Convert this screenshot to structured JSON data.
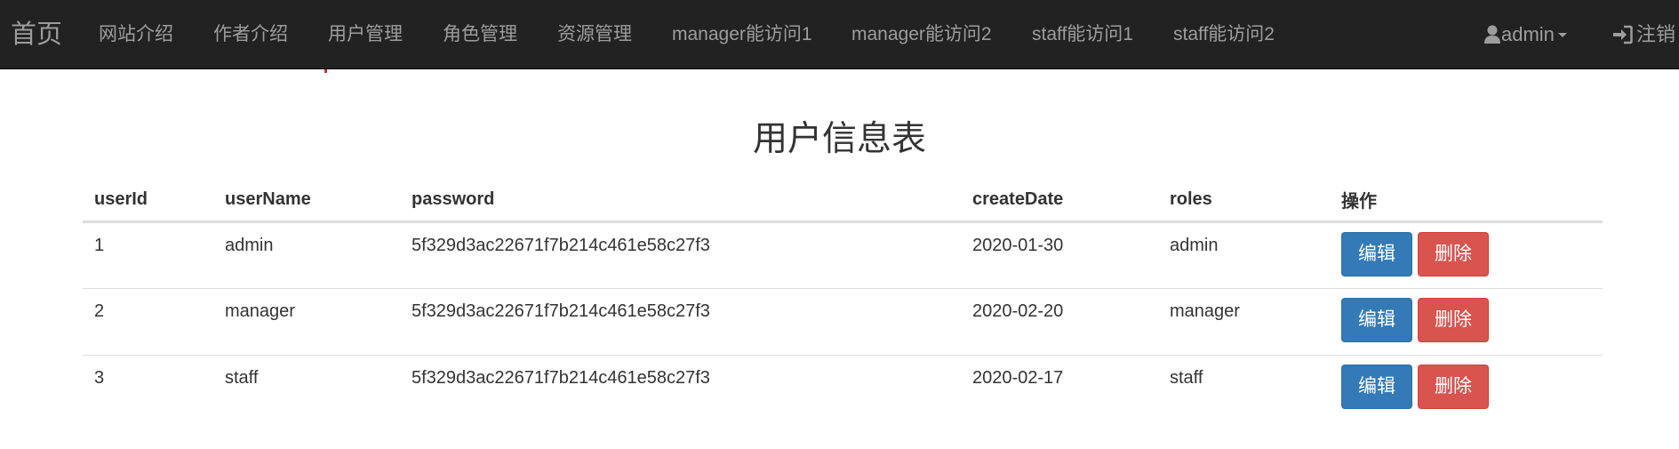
{
  "navbar": {
    "brand": "首页",
    "items": [
      {
        "label": "网站介绍"
      },
      {
        "label": "作者介绍"
      },
      {
        "label": "用户管理"
      },
      {
        "label": "角色管理"
      },
      {
        "label": "资源管理"
      },
      {
        "label": "manager能访问1"
      },
      {
        "label": "manager能访问2"
      },
      {
        "label": "staff能访问1"
      },
      {
        "label": "staff能访问2"
      }
    ],
    "user": {
      "label": "admin",
      "icon": "user-icon"
    },
    "logout": {
      "label": "注销",
      "icon": "log-in-icon"
    },
    "colors": {
      "background": "#222222",
      "text": "#9d9d9d"
    }
  },
  "page": {
    "title": "用户信息表"
  },
  "table": {
    "headers": [
      "userId",
      "userName",
      "password",
      "createDate",
      "roles",
      "操作"
    ],
    "rows": [
      {
        "userId": "1",
        "userName": "admin",
        "password": "5f329d3ac22671f7b214c461e58c27f3",
        "createDate": "2020-01-30",
        "roles": "admin"
      },
      {
        "userId": "2",
        "userName": "manager",
        "password": "5f329d3ac22671f7b214c461e58c27f3",
        "createDate": "2020-02-20",
        "roles": "manager"
      },
      {
        "userId": "3",
        "userName": "staff",
        "password": "5f329d3ac22671f7b214c461e58c27f3",
        "createDate": "2020-02-17",
        "roles": "staff"
      }
    ],
    "actions": {
      "edit_label": "编辑",
      "delete_label": "删除"
    },
    "colors": {
      "edit": "#337ab7",
      "delete": "#d9534f"
    }
  }
}
